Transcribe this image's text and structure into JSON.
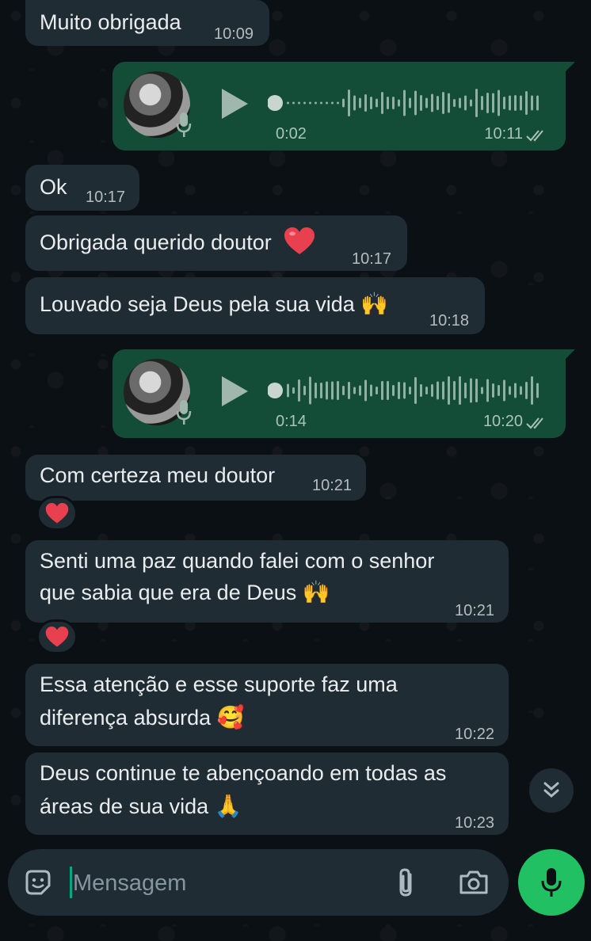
{
  "chat": {
    "messages": [
      {
        "id": "m1",
        "type": "text",
        "direction": "in",
        "text": "Muito obrigada",
        "time": "10:09"
      },
      {
        "id": "v1",
        "type": "voice",
        "direction": "out",
        "duration": "0:02",
        "time": "10:11",
        "status": "read"
      },
      {
        "id": "m2",
        "type": "text",
        "direction": "in",
        "text": "Ok",
        "time": "10:17"
      },
      {
        "id": "m3",
        "type": "text",
        "direction": "in",
        "text": "Obrigada querido doutor",
        "emoji": "heart",
        "time": "10:17"
      },
      {
        "id": "m4",
        "type": "text",
        "direction": "in",
        "text": "Louvado seja Deus pela sua vida",
        "emoji": "raising-hands",
        "time": "10:18"
      },
      {
        "id": "v2",
        "type": "voice",
        "direction": "out",
        "duration": "0:14",
        "time": "10:20",
        "status": "read"
      },
      {
        "id": "m5",
        "type": "text",
        "direction": "in",
        "text": "Com certeza meu doutor",
        "time": "10:21",
        "reaction": "heart"
      },
      {
        "id": "m6",
        "type": "text",
        "direction": "in",
        "lines": [
          "Senti uma paz quando falei com o senhor",
          "que sabia que era de Deus"
        ],
        "emoji": "raising-hands",
        "time": "10:21",
        "reaction": "heart"
      },
      {
        "id": "m7",
        "type": "text",
        "direction": "in",
        "lines": [
          "Essa atenção e esse suporte faz uma",
          "diferença absurda"
        ],
        "emoji": "smiling-face-with-hearts",
        "time": "10:22"
      },
      {
        "id": "m8",
        "type": "text",
        "direction": "in",
        "lines": [
          "Deus continue te abençoando em todas as",
          "áreas de sua vida"
        ],
        "emoji": "folded-hands",
        "time": "10:23"
      }
    ]
  },
  "composer": {
    "placeholder": "Mensagem",
    "icons": [
      "sticker-icon",
      "attach-icon",
      "camera-icon",
      "mic-icon"
    ]
  },
  "scroll_button": {
    "icon": "double-chevron-down-icon"
  },
  "colors": {
    "background": "#0b1014",
    "incoming_bubble": "#1f2c33",
    "outgoing_bubble": "#144d37",
    "accent": "#21c063",
    "heart": "#e8404e"
  }
}
